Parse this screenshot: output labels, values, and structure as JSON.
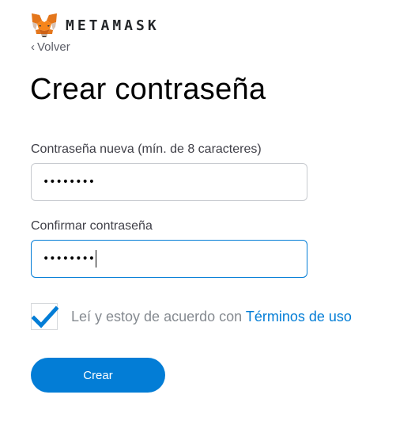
{
  "brand": {
    "name": "METAMASK",
    "logo_icon": "metamask-fox-icon"
  },
  "nav": {
    "back_label": "Volver",
    "back_icon": "chevron-left-icon"
  },
  "page": {
    "title": "Crear contraseña"
  },
  "form": {
    "new_password": {
      "label": "Contraseña nueva (mín. de 8 caracteres)",
      "masked_value": "••••••••"
    },
    "confirm_password": {
      "label": "Confirmar contraseña",
      "masked_value": "••••••••",
      "focused": true
    },
    "terms": {
      "checked": true,
      "text": "Leí y estoy de acuerdo con ",
      "link_text": "Términos de uso",
      "check_icon": "checkmark-icon"
    },
    "submit_label": "Crear"
  },
  "colors": {
    "accent": "#037dd6",
    "fox_orange": "#e2761b",
    "text_muted": "#858a90"
  }
}
